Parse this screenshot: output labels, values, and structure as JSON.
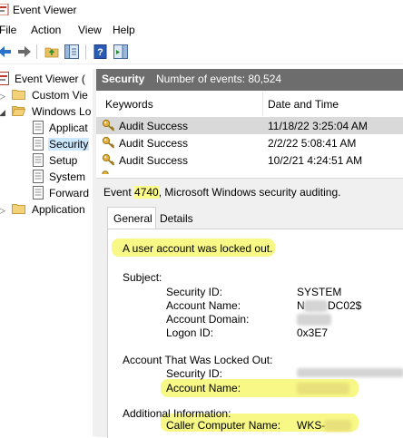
{
  "window": {
    "title": "Event Viewer"
  },
  "menu": {
    "file": "File",
    "action": "Action",
    "view": "View",
    "help": "Help"
  },
  "tree": {
    "root": "Event Viewer (",
    "custom_views": "Custom Vie",
    "windows_logs": "Windows Lo",
    "application": "Applicat",
    "security": "Security",
    "setup": "Setup",
    "system": "System",
    "forwarded": "Forward",
    "applications_services": "Application"
  },
  "header": {
    "log_name": "Security",
    "event_count": "Number of events: 80,524"
  },
  "grid": {
    "col_keywords": "Keywords",
    "col_datetime": "Date and Time",
    "rows": [
      {
        "keyword": "Audit Success",
        "datetime": "11/18/22 3:25:04 AM"
      },
      {
        "keyword": "Audit Success",
        "datetime": "2/2/22 5:08:41 AM"
      },
      {
        "keyword": "Audit Success",
        "datetime": "10/2/21 4:24:51 AM"
      }
    ]
  },
  "event": {
    "prefix": "Event ",
    "id": "4740",
    "suffix": ", Microsoft Windows security auditing.",
    "tab_general": "General",
    "tab_details": "Details",
    "message": "A user account was locked out.",
    "subject_heading": "Subject:",
    "subject": {
      "security_id_label": "Security ID:",
      "security_id_value": "SYSTEM",
      "account_name_label": "Account Name:",
      "account_name_value": "DC02$",
      "account_name_prefix": "N",
      "account_domain_label": "Account Domain:",
      "logon_id_label": "Logon ID:",
      "logon_id_value": "0x3E7"
    },
    "locked_heading": "Account That Was Locked Out:",
    "locked": {
      "security_id_label": "Security ID:",
      "account_name_label": "Account Name:"
    },
    "additional_heading": "Additional Information:",
    "additional": {
      "caller_label": "Caller Computer Name:",
      "caller_value": "WKS-"
    }
  },
  "colors": {
    "header_bg": "#6d6d6d",
    "highlight": "#f7f772",
    "selection": "#cce8ff"
  }
}
